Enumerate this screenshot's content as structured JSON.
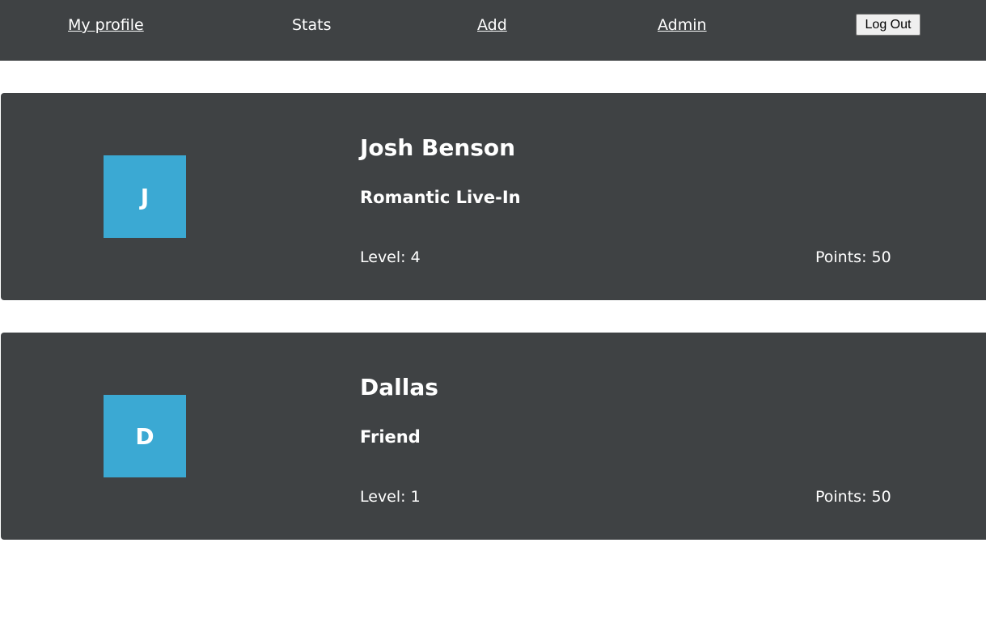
{
  "nav": {
    "my_profile": "My profile",
    "stats": "Stats",
    "add": "Add",
    "admin": "Admin",
    "logout": "Log Out"
  },
  "people": [
    {
      "initial": "J",
      "name": "Josh Benson",
      "relationship": "Romantic Live-In",
      "level_label": "Level: 4",
      "points_label": "Points: 50"
    },
    {
      "initial": "D",
      "name": "Dallas",
      "relationship": "Friend",
      "level_label": "Level: 1",
      "points_label": "Points: 50"
    }
  ],
  "colors": {
    "navbar_bg": "#3f4244",
    "card_bg": "#3f4244",
    "avatar_bg": "#3ba9d3",
    "text": "#ffffff"
  }
}
